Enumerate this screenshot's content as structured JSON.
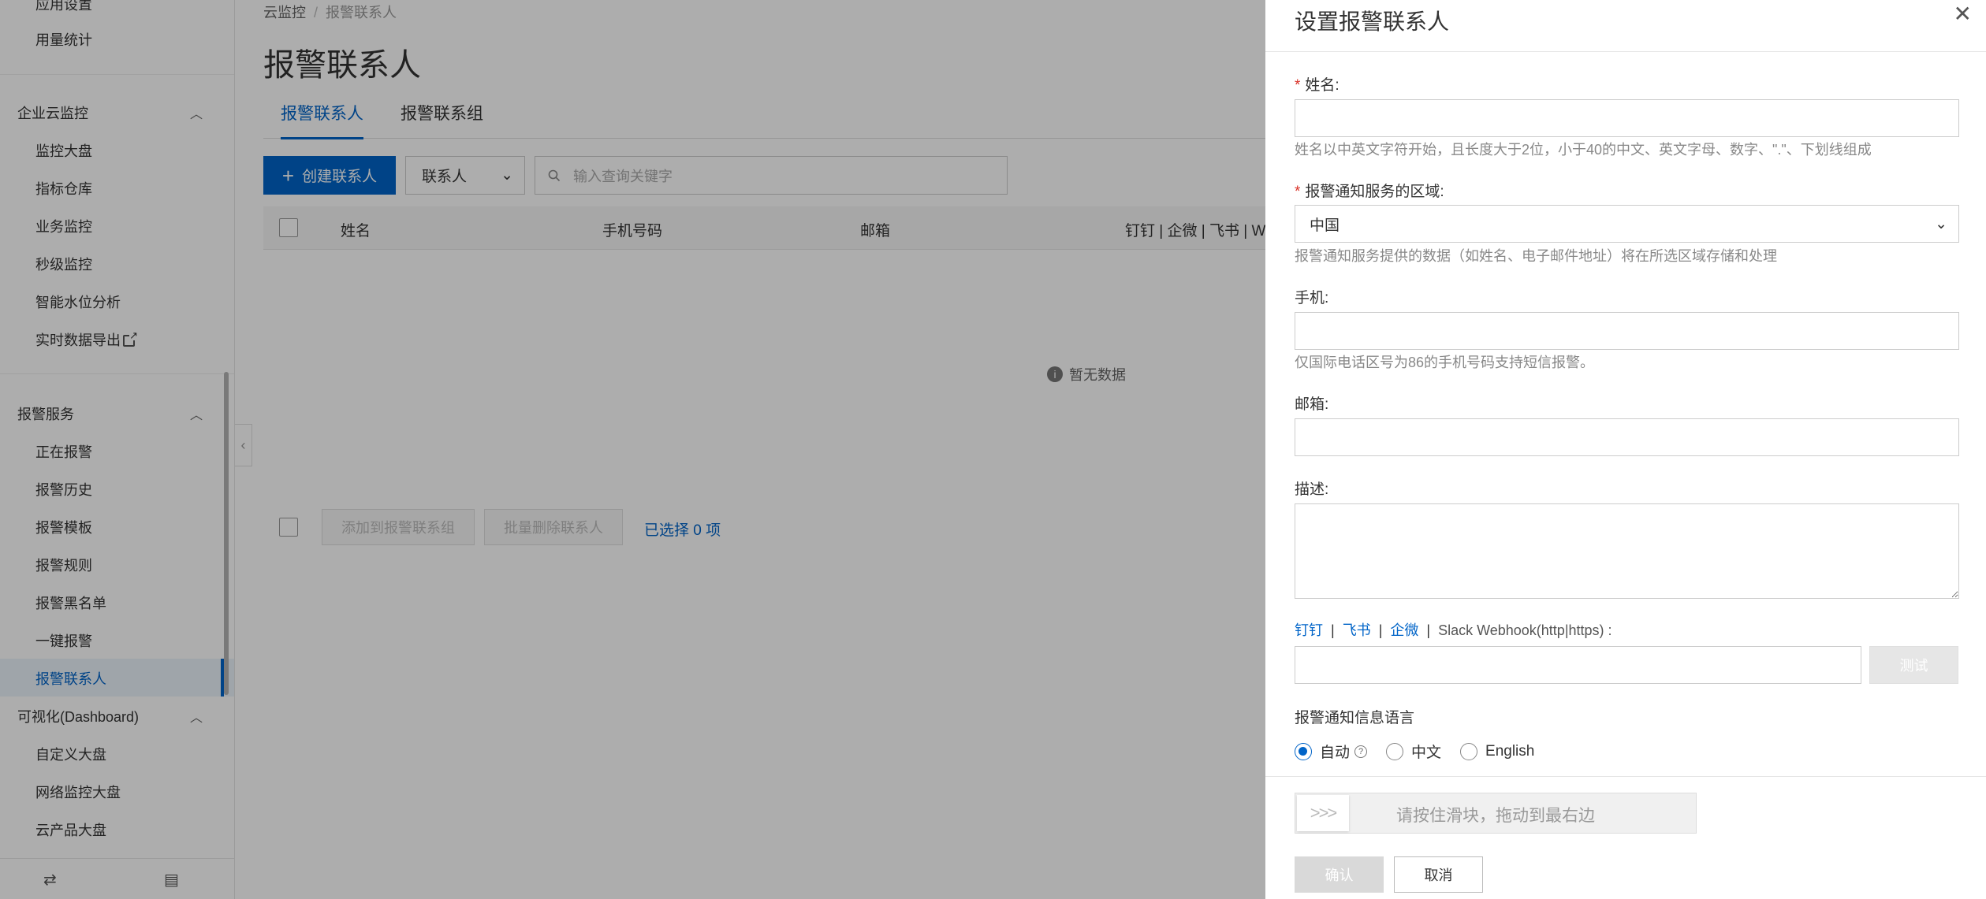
{
  "sidebar": {
    "top_items": [
      "应用设置",
      "用量统计"
    ],
    "groups": [
      {
        "title": "企业云监控",
        "items": [
          "监控大盘",
          "指标仓库",
          "业务监控",
          "秒级监控",
          "智能水位分析",
          "实时数据导出"
        ]
      },
      {
        "title": "报警服务",
        "items": [
          "正在报警",
          "报警历史",
          "报警模板",
          "报警规则",
          "报警黑名单",
          "一键报警",
          "报警联系人"
        ]
      },
      {
        "title": "可视化(Dashboard)",
        "items": [
          "自定义大盘",
          "网络监控大盘",
          "云产品大盘"
        ]
      }
    ],
    "active_item": "报警联系人"
  },
  "main": {
    "breadcrumb": [
      "云监控",
      "报警联系人"
    ],
    "title": "报警联系人",
    "tabs": [
      "报警联系人",
      "报警联系组"
    ],
    "create_button": "创建联系人",
    "filter_select": "联系人",
    "search_placeholder": "输入查询关键字",
    "columns": [
      "姓名",
      "手机号码",
      "邮箱",
      "钉钉 | 企微 | 飞书 | W"
    ],
    "empty_text": "暂无数据",
    "add_to_group_button": "添加到报警联系组",
    "batch_delete_button": "批量删除联系人",
    "selected_count": "已选择 0 项"
  },
  "drawer": {
    "title": "设置报警联系人",
    "name_label": "姓名:",
    "name_help": "姓名以中英文字符开始，且长度大于2位，小于40的中文、英文字母、数字、\".\"、下划线组成",
    "region_label": "报警通知服务的区域:",
    "region_value": "中国",
    "region_help": "报警通知服务提供的数据（如姓名、电子邮件地址）将在所选区域存储和处理",
    "phone_label": "手机:",
    "phone_help": "仅国际电话区号为86的手机号码支持短信报警。",
    "email_label": "邮箱:",
    "desc_label": "描述:",
    "webhook_links": [
      "钉钉",
      "飞书",
      "企微"
    ],
    "webhook_text": "Slack Webhook(http|https) :",
    "test_button": "测试",
    "lang_label": "报警通知信息语言",
    "lang_options": [
      "自动",
      "中文",
      "English"
    ],
    "lang_selected": "自动",
    "slider_text": "请按住滑块，拖动到最右边",
    "slider_handle": ">>>",
    "ok_button": "确认",
    "cancel_button": "取消"
  },
  "colors": {
    "accent": "#0064c8",
    "required": "#d93026"
  }
}
